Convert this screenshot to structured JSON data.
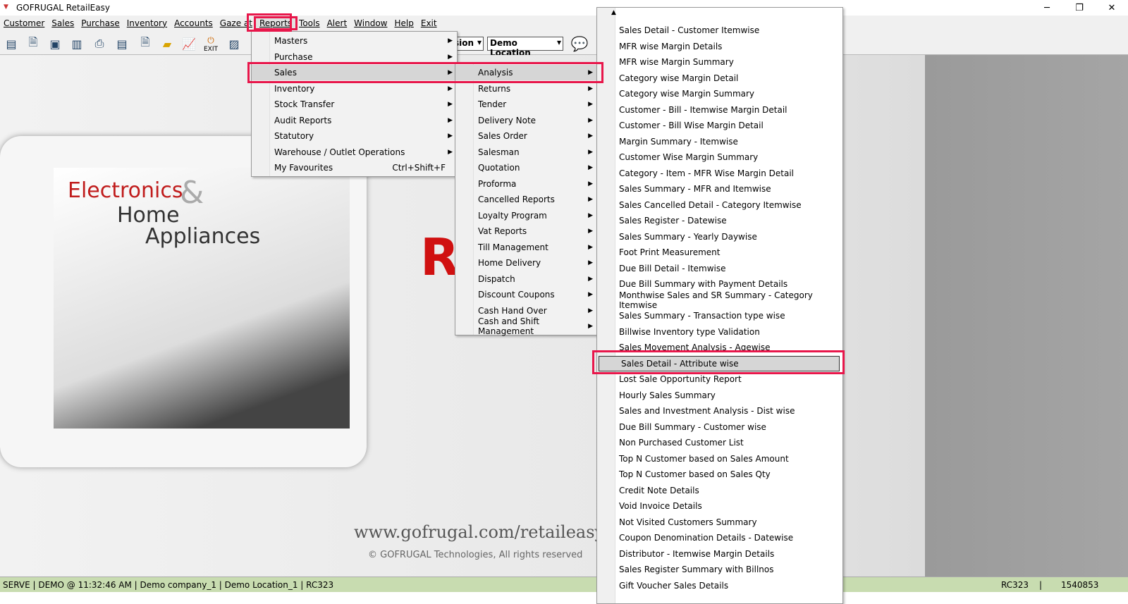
{
  "window": {
    "title": "GOFRUGAL RetailEasy",
    "minimize": "─",
    "restore": "❐",
    "close": "✕"
  },
  "menubar": [
    "Customer",
    "Sales",
    "Purchase",
    "Inventory",
    "Accounts",
    "Gaze at",
    "Reports",
    "Tools",
    "Alert",
    "Window",
    "Help",
    "Exit"
  ],
  "toolbar": {
    "exit_label": "EXIT",
    "combo1": "sion",
    "combo2": "Demo Location"
  },
  "banner": {
    "line1": "Electronics",
    "amp": "&",
    "line2": "Home",
    "line3": "Appliances",
    "brand_letter": "R",
    "url": "www.gofrugal.com/retaileasy",
    "copyright": "© GOFRUGAL Technologies, All rights reserved"
  },
  "reports_menu": [
    {
      "label": "Masters",
      "sub": true
    },
    {
      "label": "Purchase",
      "sub": true
    },
    {
      "label": "Sales",
      "sub": true,
      "active": true
    },
    {
      "label": "Inventory",
      "sub": true
    },
    {
      "label": "Stock Transfer",
      "sub": true
    },
    {
      "label": "Audit Reports",
      "sub": true
    },
    {
      "label": "Statutory",
      "sub": true
    },
    {
      "label": "Warehouse / Outlet Operations",
      "sub": true
    },
    {
      "label": "My Favourites",
      "shortcut": "Ctrl+Shift+F"
    }
  ],
  "sales_menu": [
    "Analysis",
    "Returns",
    "Tender",
    "Delivery Note",
    "Sales Order",
    "Salesman",
    "Quotation",
    "Proforma",
    "Cancelled Reports",
    "Loyalty Program",
    "Vat Reports",
    "Till Management",
    "Home Delivery",
    "Dispatch",
    "Discount Coupons",
    "Cash Hand Over",
    "Cash and Shift Management"
  ],
  "analysis_menu": {
    "selected_index": 21,
    "items": [
      "Sales Detail - Customer Itemwise",
      "MFR wise Margin Details",
      "MFR wise Margin Summary",
      "Category wise Margin Detail",
      "Category wise Margin Summary",
      "Customer - Bill - Itemwise Margin Detail",
      "Customer - Bill Wise Margin Detail",
      "Margin Summary - Itemwise",
      "Customer Wise Margin Summary",
      "Category - Item - MFR Wise Margin Detail",
      "Sales Summary - MFR and Itemwise",
      "Sales Cancelled Detail - Category Itemwise",
      "Sales Register - Datewise",
      "Sales Summary - Yearly Daywise",
      "Foot Print Measurement",
      "Due Bill Detail - Itemwise",
      "Due Bill Summary with Payment Details",
      "Monthwise Sales and SR Summary - Category Itemwise",
      "Sales Summary - Transaction type wise",
      "Billwise Inventory type Validation",
      "Sales Movement Analysis - Agewise",
      "Sales Detail - Attribute wise",
      "Lost Sale Opportunity Report",
      "Hourly Sales Summary",
      "Sales and Investment Analysis - Dist wise",
      "Due Bill Summary - Customer wise",
      "Non Purchased Customer List",
      "Top N Customer based on Sales Amount",
      "Top N Customer based on Sales Qty",
      "Credit Note Details",
      "Void Invoice Details",
      "Not Visited Customers Summary",
      "Coupon Denomination Details - Datewise",
      "Distributor - Itemwise Margin Details",
      "Sales Register Summary with Billnos",
      "Gift Voucher Sales Details"
    ]
  },
  "status": {
    "left": "SERVE | DEMO  @ 11:32:46 AM   | Demo company_1   | Demo Location_1 | RC323",
    "code": "RC323",
    "sep": "|",
    "number": "1540853"
  }
}
